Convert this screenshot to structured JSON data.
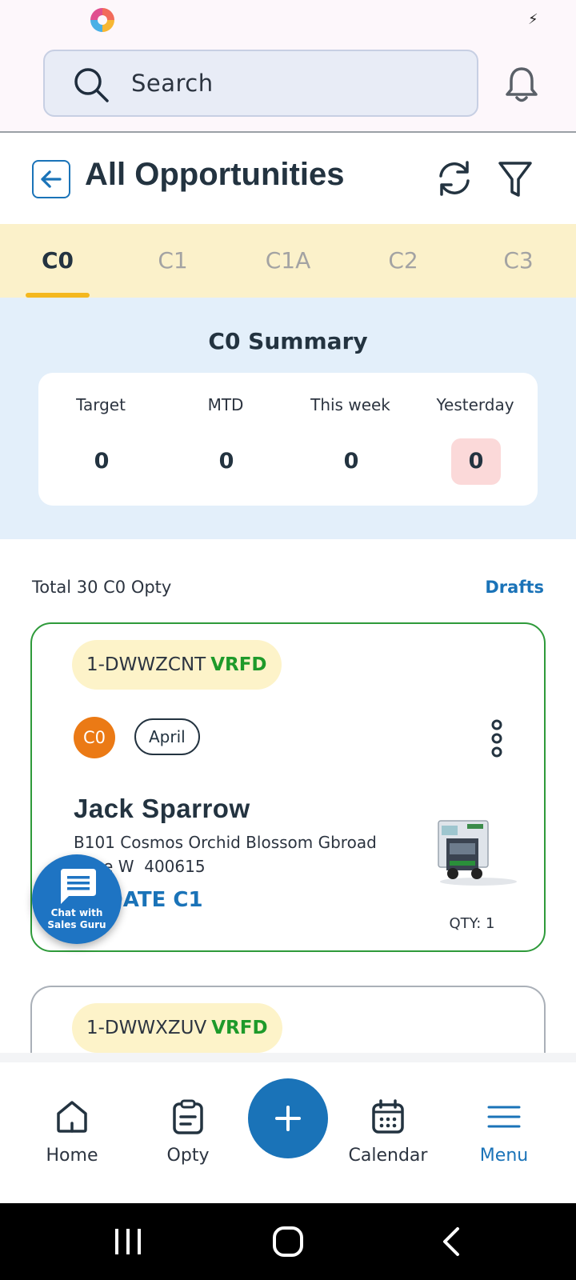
{
  "search": {
    "placeholder": "Search"
  },
  "header": {
    "title": "All Opportunities"
  },
  "tabs": [
    {
      "label": "C0",
      "active": true
    },
    {
      "label": "C1",
      "active": false
    },
    {
      "label": "C1A",
      "active": false
    },
    {
      "label": "C2",
      "active": false
    },
    {
      "label": "C3",
      "active": false
    }
  ],
  "summary": {
    "title": "C0 Summary",
    "stats": [
      {
        "label": "Target",
        "value": "0"
      },
      {
        "label": "MTD",
        "value": "0"
      },
      {
        "label": "This week",
        "value": "0"
      },
      {
        "label": "Yesterday",
        "value": "0"
      }
    ]
  },
  "list": {
    "total_text": "Total 30 C0 Opty",
    "drafts_label": "Drafts"
  },
  "cards": [
    {
      "id": "1-DWWZCNT",
      "status": "VRFD",
      "stage": "C0",
      "month": "April",
      "customer_name": "Jack Sparrow",
      "address_line1": "B101 Cosmos Orchid Blossom Gbroad",
      "address_line2": "Pune W  400615",
      "action": "UPDATE C1",
      "qty": "QTY: 1"
    },
    {
      "id": "1-DWWXZUV",
      "status": "VRFD"
    }
  ],
  "chat": {
    "line1": "Chat with",
    "line2": "Sales Guru"
  },
  "nav": {
    "home": "Home",
    "opty": "Opty",
    "calendar": "Calendar",
    "menu": "Menu"
  },
  "colors": {
    "primary": "#1a73b8",
    "tab_bg": "#fbf1ca",
    "summary_bg": "#e3effa",
    "verified": "#1e9a2a",
    "stage_c0": "#eb7a15"
  }
}
